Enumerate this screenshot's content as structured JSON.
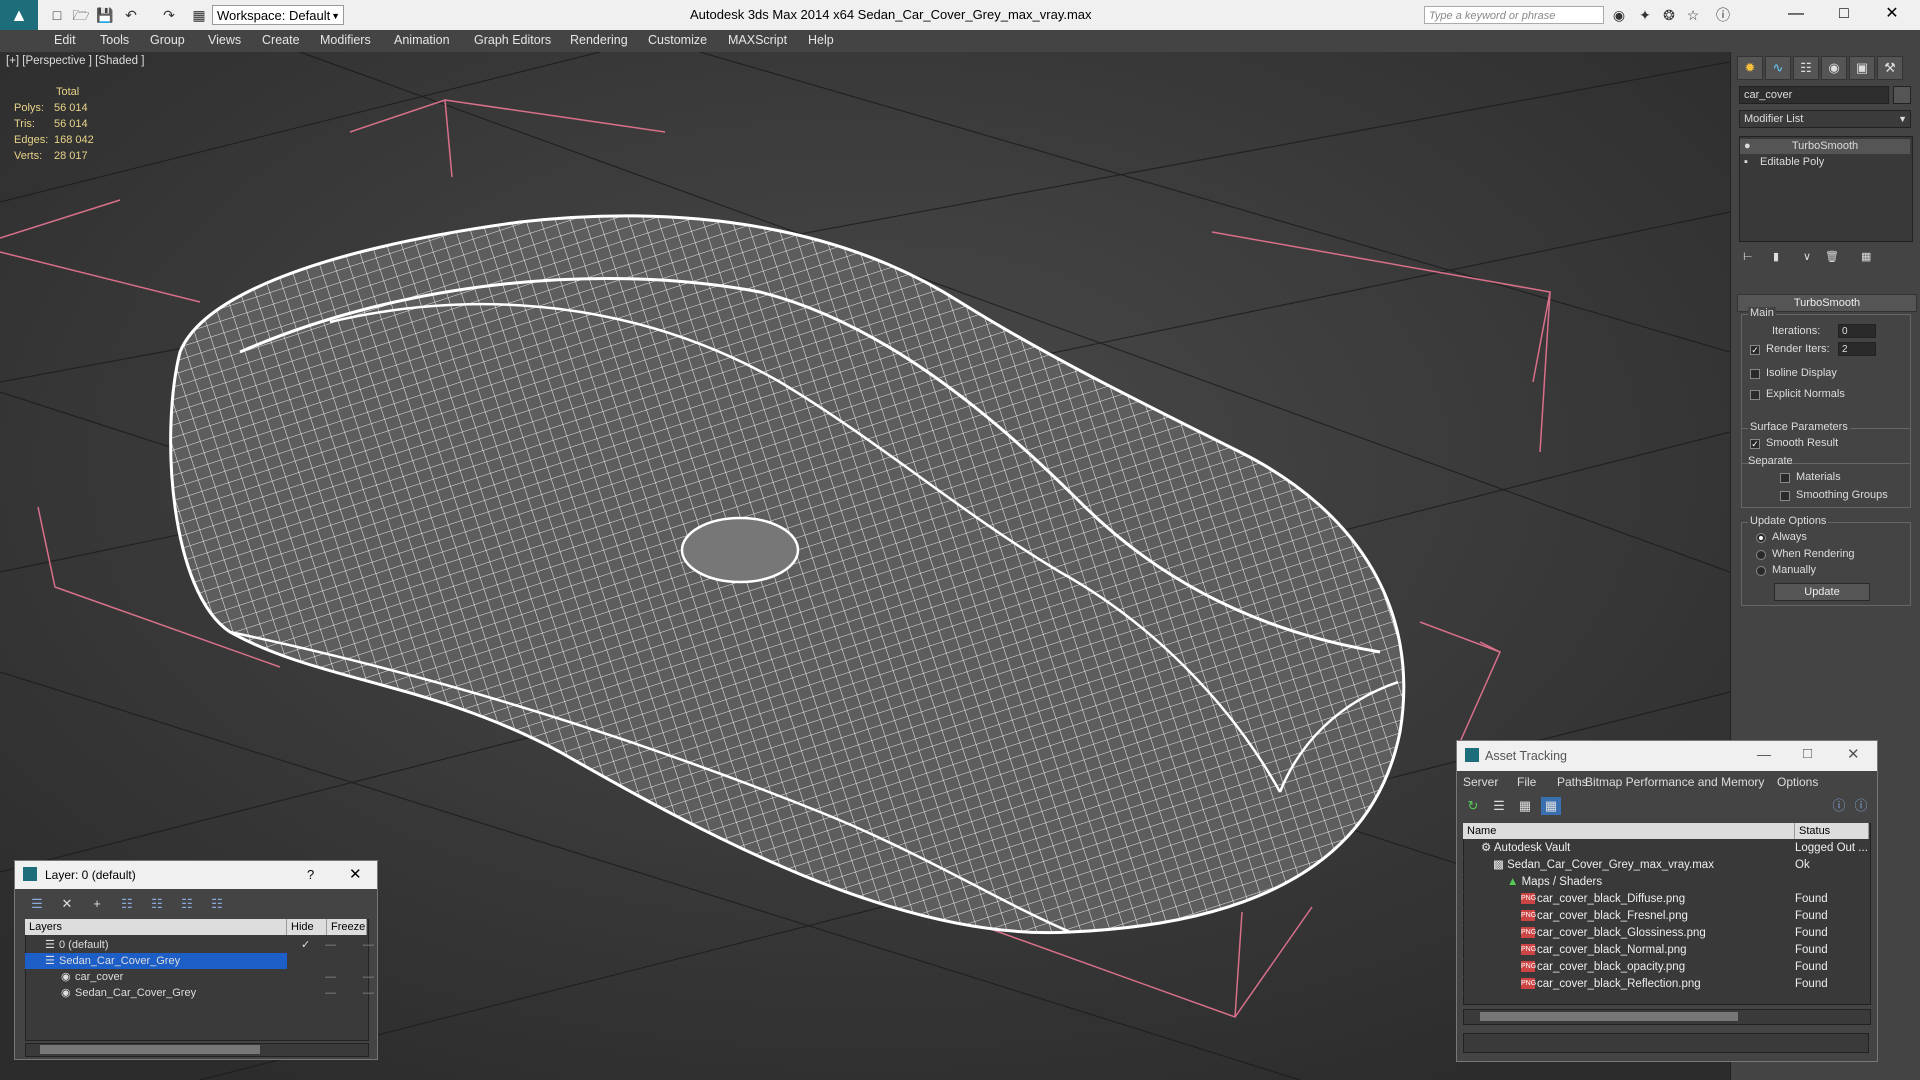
{
  "titlebar": {
    "app_title": "Autodesk 3ds Max  2014 x64      Sedan_Car_Cover_Grey_max_vray.max",
    "workspace": "Workspace: Default",
    "search_placeholder": "Type a keyword or phrase"
  },
  "menubar": [
    "Edit",
    "Tools",
    "Group",
    "Views",
    "Create",
    "Modifiers",
    "Animation",
    "Graph Editors",
    "Rendering",
    "Customize",
    "MAXScript",
    "Help"
  ],
  "viewport": {
    "label": "[+] [Perspective ] [Shaded ]",
    "stats_header": "Total",
    "stats": [
      {
        "label": "Polys:",
        "value": "56 014"
      },
      {
        "label": "Tris:",
        "value": "56 014"
      },
      {
        "label": "Edges:",
        "value": "168 042"
      },
      {
        "label": "Verts:",
        "value": "28 017"
      }
    ]
  },
  "cmdpanel": {
    "object_name": "car_cover",
    "modifier_list": "Modifier List",
    "stack": [
      "TurboSmooth",
      "Editable Poly"
    ],
    "rollout_title": "TurboSmooth",
    "main_group": "Main",
    "iterations_label": "Iterations:",
    "iterations_value": "0",
    "render_iters_label": "Render Iters:",
    "render_iters_value": "2",
    "isoline": "Isoline Display",
    "explicit_normals": "Explicit Normals",
    "surface_group": "Surface Parameters",
    "smooth_result": "Smooth Result",
    "separate": "Separate",
    "materials": "Materials",
    "smoothing_groups": "Smoothing Groups",
    "update_group": "Update Options",
    "always": "Always",
    "when_rendering": "When Rendering",
    "manually": "Manually",
    "update_button": "Update"
  },
  "layer_window": {
    "title": "Layer: 0 (default)",
    "help": "?",
    "col_layers": "Layers",
    "col_hide": "Hide",
    "col_freeze": "Freeze",
    "rows": [
      {
        "name": "0 (default)"
      },
      {
        "name": "Sedan_Car_Cover_Grey"
      },
      {
        "name": "car_cover"
      },
      {
        "name": "Sedan_Car_Cover_Grey"
      }
    ]
  },
  "asset_window": {
    "title": "Asset Tracking",
    "menu": [
      "Server",
      "File",
      "Paths",
      "Bitmap Performance and Memory",
      "Options"
    ],
    "col_name": "Name",
    "col_status": "Status",
    "rows": [
      {
        "name": "Autodesk Vault",
        "status": "Logged Out ..."
      },
      {
        "name": "Sedan_Car_Cover_Grey_max_vray.max",
        "status": "Ok"
      },
      {
        "name": "Maps / Shaders",
        "status": ""
      },
      {
        "name": "car_cover_black_Diffuse.png",
        "status": "Found"
      },
      {
        "name": "car_cover_black_Fresnel.png",
        "status": "Found"
      },
      {
        "name": "car_cover_black_Glossiness.png",
        "status": "Found"
      },
      {
        "name": "car_cover_black_Normal.png",
        "status": "Found"
      },
      {
        "name": "car_cover_black_opacity.png",
        "status": "Found"
      },
      {
        "name": "car_cover_black_Reflection.png",
        "status": "Found"
      }
    ]
  },
  "colors": {
    "accent": "#3a7bd5",
    "selection": "#1e5fc7",
    "wire": "#ffffff",
    "bbox": "#d8708a"
  }
}
